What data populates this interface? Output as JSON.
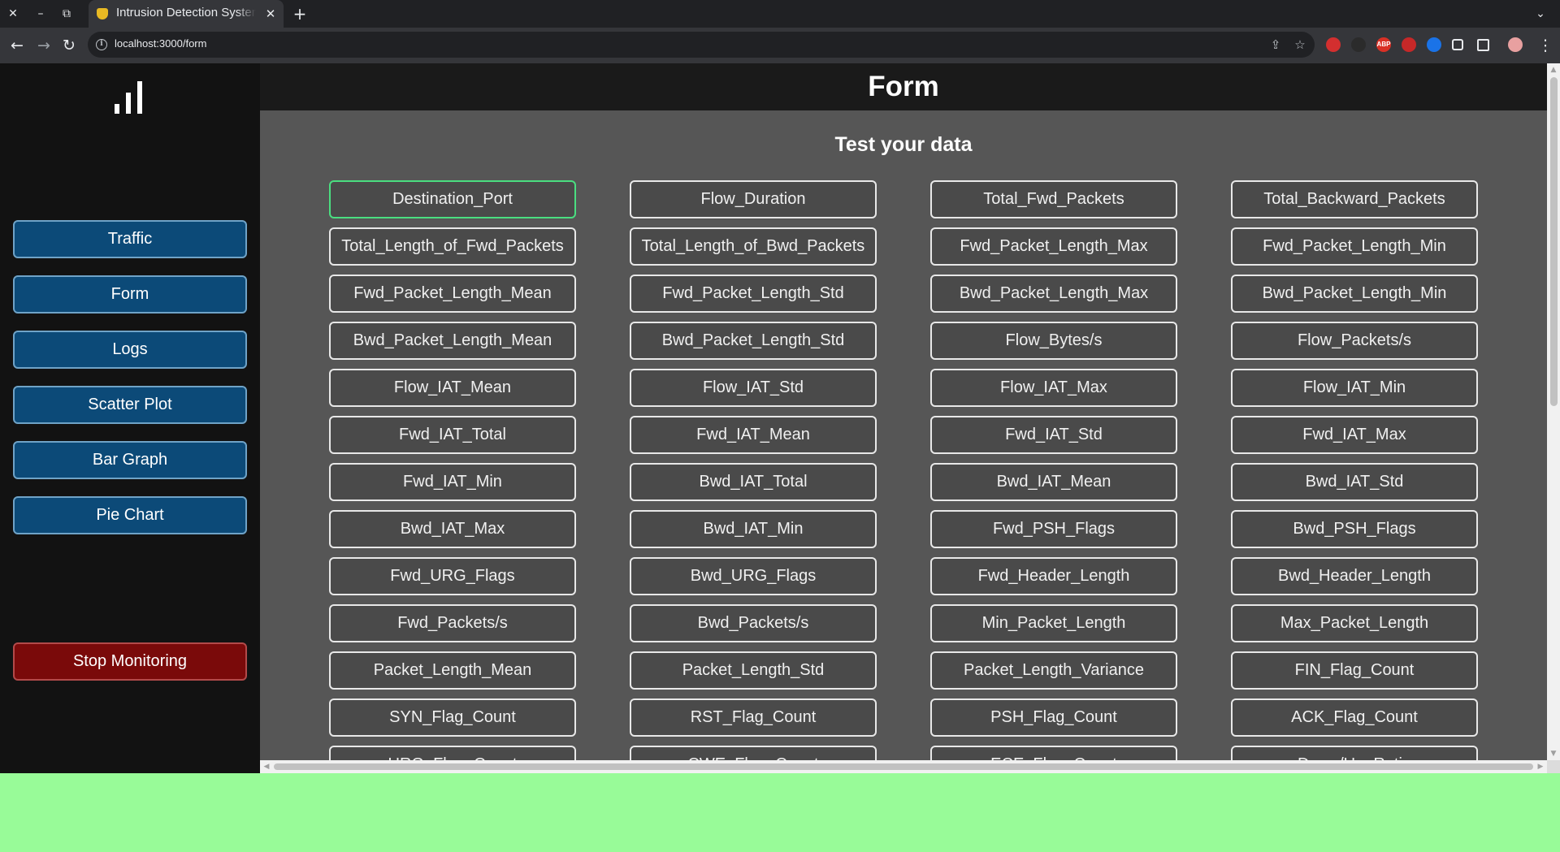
{
  "browser": {
    "tab_title": "Intrusion Detection System",
    "url": "localhost:3000/form",
    "window_controls": {
      "close": "✕",
      "minimize": "–",
      "restore": "⧉"
    },
    "tab_close": "✕",
    "new_tab": "+",
    "tab_list": "⌄",
    "nav": {
      "back": "←",
      "forward": "→",
      "reload": "↻"
    },
    "url_info": "i",
    "share": "⇪",
    "bookmark": "☆",
    "extensions": [
      {
        "name": "extension-red-icon",
        "color": "#d32f2f",
        "label": ""
      },
      {
        "name": "extension-dark-icon",
        "color": "#2b2b2b",
        "label": ""
      },
      {
        "name": "adblock-plus-icon",
        "color": "#d93025",
        "label": "ABP"
      },
      {
        "name": "extension-shield-icon",
        "color": "#c62828",
        "label": ""
      },
      {
        "name": "extension-blue-icon",
        "color": "#1a73e8",
        "label": ""
      },
      {
        "name": "puzzle-icon",
        "color": "#35363a",
        "label": ""
      },
      {
        "name": "side-panel-icon",
        "color": "#35363a",
        "label": ""
      },
      {
        "name": "profile-avatar-icon",
        "color": "#e8a0a0",
        "label": ""
      }
    ],
    "menu": "⋮"
  },
  "sidebar": {
    "logo_icon": "bar-chart-icon",
    "items": [
      {
        "label": "Traffic"
      },
      {
        "label": "Form"
      },
      {
        "label": "Logs"
      },
      {
        "label": "Scatter Plot"
      },
      {
        "label": "Bar Graph"
      },
      {
        "label": "Pie Chart"
      }
    ],
    "stop_label": "Stop Monitoring"
  },
  "main": {
    "title": "Form",
    "subtitle": "Test your data",
    "fields": [
      "Destination_Port",
      "Flow_Duration",
      "Total_Fwd_Packets",
      "Total_Backward_Packets",
      "Total_Length_of_Fwd_Packets",
      "Total_Length_of_Bwd_Packets",
      "Fwd_Packet_Length_Max",
      "Fwd_Packet_Length_Min",
      "Fwd_Packet_Length_Mean",
      "Fwd_Packet_Length_Std",
      "Bwd_Packet_Length_Max",
      "Bwd_Packet_Length_Min",
      "Bwd_Packet_Length_Mean",
      "Bwd_Packet_Length_Std",
      "Flow_Bytes/s",
      "Flow_Packets/s",
      "Flow_IAT_Mean",
      "Flow_IAT_Std",
      "Flow_IAT_Max",
      "Flow_IAT_Min",
      "Fwd_IAT_Total",
      "Fwd_IAT_Mean",
      "Fwd_IAT_Std",
      "Fwd_IAT_Max",
      "Fwd_IAT_Min",
      "Bwd_IAT_Total",
      "Bwd_IAT_Mean",
      "Bwd_IAT_Std",
      "Bwd_IAT_Max",
      "Bwd_IAT_Min",
      "Fwd_PSH_Flags",
      "Bwd_PSH_Flags",
      "Fwd_URG_Flags",
      "Bwd_URG_Flags",
      "Fwd_Header_Length",
      "Bwd_Header_Length",
      "Fwd_Packets/s",
      "Bwd_Packets/s",
      "Min_Packet_Length",
      "Max_Packet_Length",
      "Packet_Length_Mean",
      "Packet_Length_Std",
      "Packet_Length_Variance",
      "FIN_Flag_Count",
      "SYN_Flag_Count",
      "RST_Flag_Count",
      "PSH_Flag_Count",
      "ACK_Flag_Count",
      "URG_Flag_Count",
      "CWE_Flag_Count",
      "ECE_Flag_Count",
      "Down/Up_Ratio"
    ],
    "focused_field": "Destination_Port"
  },
  "colors": {
    "nav_button": "#0c4a78",
    "stop_button": "#7a0a0a",
    "focus_border": "#4ade80",
    "content_bg": "#565656",
    "sidebar_bg": "#121212"
  }
}
